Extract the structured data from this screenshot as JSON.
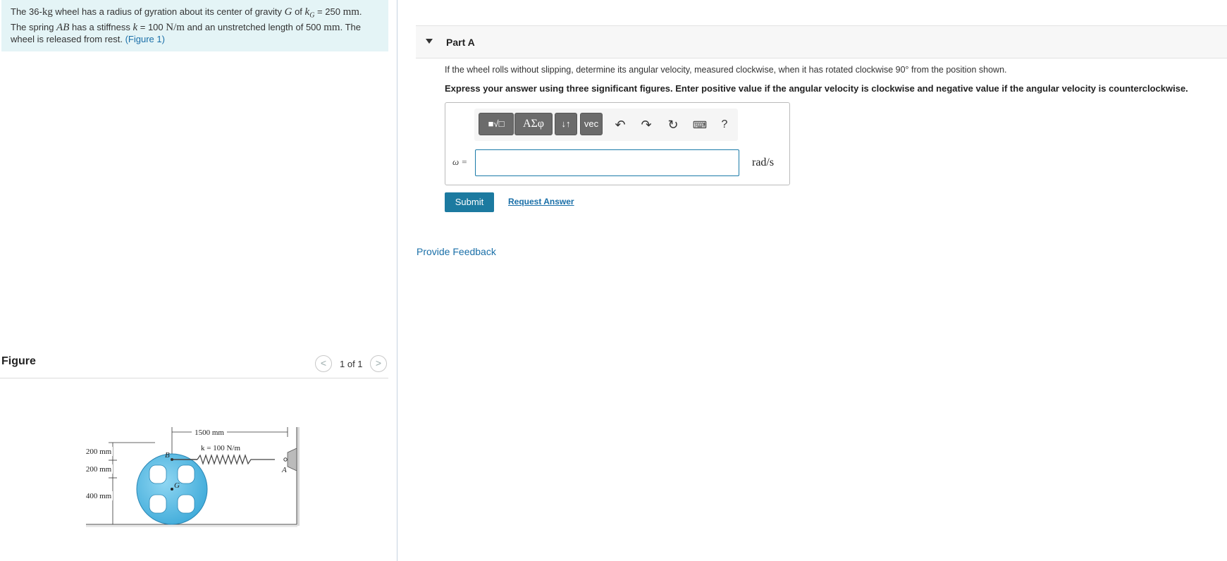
{
  "problem": {
    "p1": "The 36-",
    "kg": "kg",
    "p2": " wheel has a radius of gyration about its center of gravity ",
    "G": "G",
    "p3": " of ",
    "kG": "k",
    "kGsub": "G",
    "p4": " = 250 ",
    "mm1": "mm",
    "p5": ".",
    "p6": "The spring ",
    "AB": "AB",
    "p7": " has a stiffness ",
    "k": "k",
    "p8": " = 100 ",
    "Nm": "N/m",
    "p9": " and an unstretched length of 500 ",
    "mm2": "mm",
    "p10": ". The",
    "p11": "wheel is released from rest. ",
    "figure_link": "(Figure 1)"
  },
  "figure": {
    "title": "Figure",
    "counter": "1 of 1",
    "prev_icon": "<",
    "next_icon": ">",
    "labels": {
      "dim_1500": "1500 mm",
      "spring_k": "k = 100 N/m",
      "dim_200a": "200 mm",
      "dim_200b": "200 mm",
      "dim_400": "400 mm",
      "point_B": "B",
      "point_G": "G",
      "point_A": "A"
    }
  },
  "part": {
    "title": "Part A",
    "question": "If the wheel rolls without slipping, determine its angular velocity, measured clockwise, when it has rotated clockwise 90° from the position shown.",
    "instructions": "Express your answer using three significant figures. Enter positive value if the angular velocity is clockwise and negative value if the angular velocity is counterclockwise."
  },
  "toolbar": {
    "templates": "■√□",
    "greek": "ΑΣφ",
    "arrows": "↓↑",
    "vec": "vec",
    "undo": "↶",
    "redo": "↷",
    "reset": "↻",
    "keyboard": "⌨",
    "help": "?"
  },
  "answer": {
    "label": "ω =",
    "value": "",
    "unit": "rad/s"
  },
  "actions": {
    "submit": "Submit",
    "request": "Request Answer",
    "feedback": "Provide Feedback"
  },
  "colors": {
    "accent": "#1c7aa0",
    "problem_bg": "#e4f4f6",
    "wheel": "#5bbfe6"
  }
}
